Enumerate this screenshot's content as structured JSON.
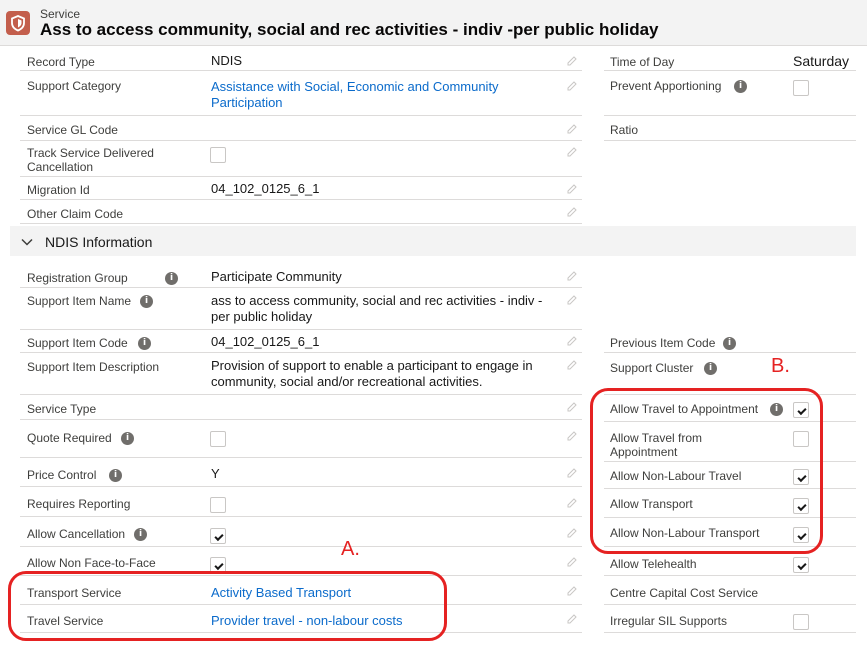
{
  "header": {
    "object_label": "Service",
    "title": "Ass to access community, social and rec activities - indiv -per public holiday",
    "icon": "service-shield-icon"
  },
  "left_fields": [
    {
      "label": "Record Type",
      "value": "NDIS"
    },
    {
      "label": "Support Category",
      "value": "Assistance with Social, Economic and Community Participation"
    },
    {
      "label": "Service GL Code",
      "value": ""
    },
    {
      "label": "Track Service Delivered Cancellation",
      "checked": false
    },
    {
      "label": "Migration Id",
      "value": "04_102_0125_6_1"
    },
    {
      "label": "Other Claim Code",
      "value": ""
    }
  ],
  "right_fields_top": [
    {
      "label": "Time of Day",
      "value": "Saturday"
    },
    {
      "label": "Prevent Apportioning",
      "checked": false
    },
    {
      "label": "Ratio",
      "value": ""
    }
  ],
  "ndis_section": {
    "title": "NDIS Information",
    "left_fields": [
      {
        "label": "Registration Group",
        "value": "Participate Community"
      },
      {
        "label": "Support Item Name",
        "value": "ass to access community, social and rec activities - indiv -per public holiday"
      },
      {
        "label": "Support Item Code",
        "value": "04_102_0125_6_1"
      },
      {
        "label": "Support Item Description",
        "value": "Provision of support to enable a participant to engage in community, social and/or recreational activities."
      },
      {
        "label": "Service Type",
        "value": ""
      },
      {
        "label": "Quote Required",
        "checked": false
      },
      {
        "label": "Price Control",
        "value": "Y"
      },
      {
        "label": "Requires Reporting",
        "checked": false
      },
      {
        "label": "Allow Cancellation",
        "checked": true
      },
      {
        "label": "Allow Non Face-to-Face",
        "checked": true
      },
      {
        "label": "Transport Service",
        "value": "Activity Based Transport"
      },
      {
        "label": "Travel Service",
        "value": "Provider travel - non-labour costs"
      }
    ],
    "right_fields": [
      {
        "label": "Previous Item Code",
        "value": ""
      },
      {
        "label": "Support Cluster",
        "value": ""
      },
      {
        "label": "Allow Travel to Appointment",
        "checked": true
      },
      {
        "label": "Allow Travel from Appointment",
        "checked": false
      },
      {
        "label": "Allow Non-Labour Travel",
        "checked": true
      },
      {
        "label": "Allow Transport",
        "checked": true
      },
      {
        "label": "Allow Non-Labour Transport",
        "checked": true
      },
      {
        "label": "Allow Telehealth",
        "checked": true
      },
      {
        "label": "Centre Capital Cost Service",
        "value": ""
      },
      {
        "label": "Irregular SIL Supports",
        "checked": false
      }
    ]
  },
  "annotations": {
    "a": "A.",
    "b": "B."
  },
  "colors": {
    "accent_red": "#e52222",
    "link": "#0b6bcb",
    "icon_bg": "#c35e4c"
  }
}
